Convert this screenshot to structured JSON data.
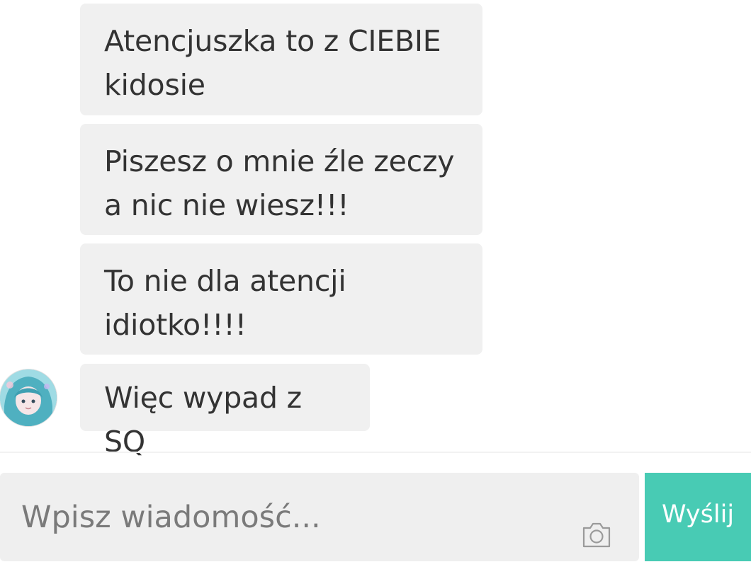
{
  "messages": [
    {
      "text": "Atencjuszka to z CIEBIE\nkidosie"
    },
    {
      "text": "Piszesz o mnie źle zeczy\na nic nie wiesz!!!"
    },
    {
      "text": "To nie dla atencji\nidiotko!!!!"
    },
    {
      "text": "Więc wypad z SQ"
    }
  ],
  "composer": {
    "placeholder": "Wpisz wiadomość...",
    "value": "",
    "send_label": "Wyślij",
    "camera_icon": "camera-icon"
  },
  "colors": {
    "bubble_bg": "#f0f0f0",
    "send_bg": "#48cbb4",
    "input_bg": "#efefef"
  }
}
